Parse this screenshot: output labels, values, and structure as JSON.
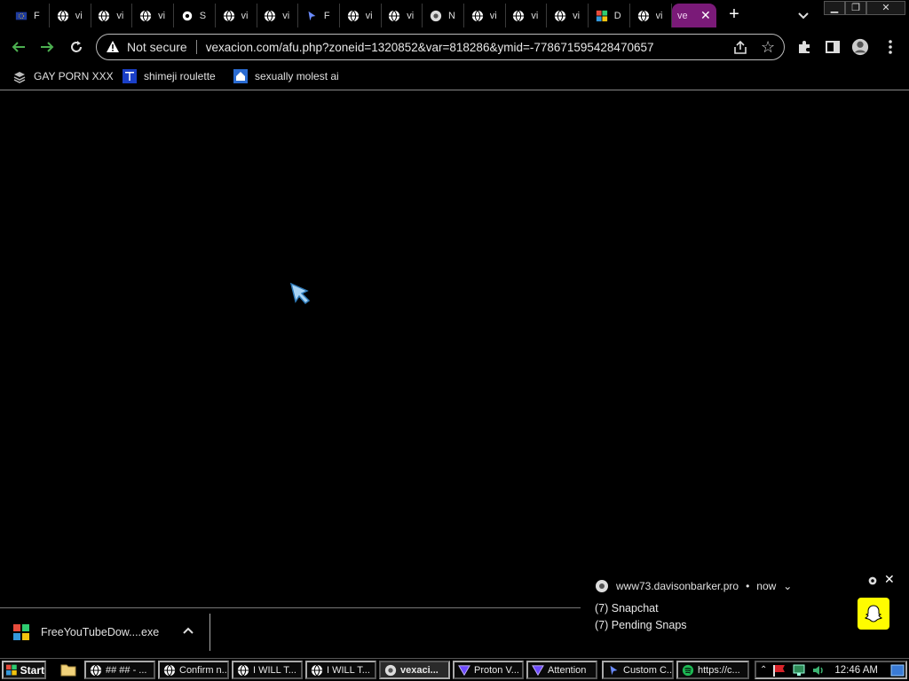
{
  "tabs": [
    {
      "title": "F",
      "icon": "flag-icon"
    },
    {
      "title": "vi",
      "icon": "globe-icon"
    },
    {
      "title": "vi",
      "icon": "globe-icon"
    },
    {
      "title": "vi",
      "icon": "globe-icon"
    },
    {
      "title": "S",
      "icon": "gear-icon"
    },
    {
      "title": "vi",
      "icon": "globe-icon"
    },
    {
      "title": "vi",
      "icon": "globe-icon"
    },
    {
      "title": "F",
      "icon": "cursor-icon"
    },
    {
      "title": "vi",
      "icon": "globe-icon"
    },
    {
      "title": "vi",
      "icon": "globe-icon"
    },
    {
      "title": "N",
      "icon": "chrome-icon"
    },
    {
      "title": "vi",
      "icon": "globe-icon"
    },
    {
      "title": "vi",
      "icon": "globe-icon"
    },
    {
      "title": "vi",
      "icon": "globe-icon"
    },
    {
      "title": "D",
      "icon": "microsoft-icon"
    },
    {
      "title": "vi",
      "icon": "globe-icon"
    }
  ],
  "active_tab": {
    "title": "ve",
    "color": "#7a1a78"
  },
  "omnibox": {
    "security_label": "Not secure",
    "url": "vexacion.com/afu.php?zoneid=1320852&var=818286&ymid=-778671595428470657"
  },
  "bookmarks": [
    {
      "label": "GAY PORN XXX",
      "icon": "stack-icon"
    },
    {
      "label": "shimeji roulette",
      "icon": "mft-icon"
    },
    {
      "label": "sexually molest ai",
      "icon": "house-icon"
    }
  ],
  "download": {
    "filename": "FreeYouTubeDow....exe"
  },
  "notification": {
    "source": "www73.davisonbarker.pro",
    "time": "now",
    "title": "(7) Snapchat",
    "body": "(7) Pending Snaps",
    "image_color": "#fffc00"
  },
  "taskbar": {
    "start_label": "Start",
    "tasks": [
      {
        "label": "## ## - ...",
        "icon": "globe-icon"
      },
      {
        "label": "Confirm n...",
        "icon": "globe-icon"
      },
      {
        "label": "I WILL T...",
        "icon": "globe-icon"
      },
      {
        "label": "I WILL T...",
        "icon": "globe-icon"
      },
      {
        "label": "vexaci...",
        "icon": "chrome-icon",
        "active": true
      },
      {
        "label": "Proton V...",
        "icon": "proton-icon"
      },
      {
        "label": "Attention",
        "icon": "proton-icon"
      },
      {
        "label": "Custom C...",
        "icon": "cursor-icon"
      },
      {
        "label": "https://c...",
        "icon": "spotify-icon"
      }
    ],
    "clock": "12:46 AM"
  }
}
